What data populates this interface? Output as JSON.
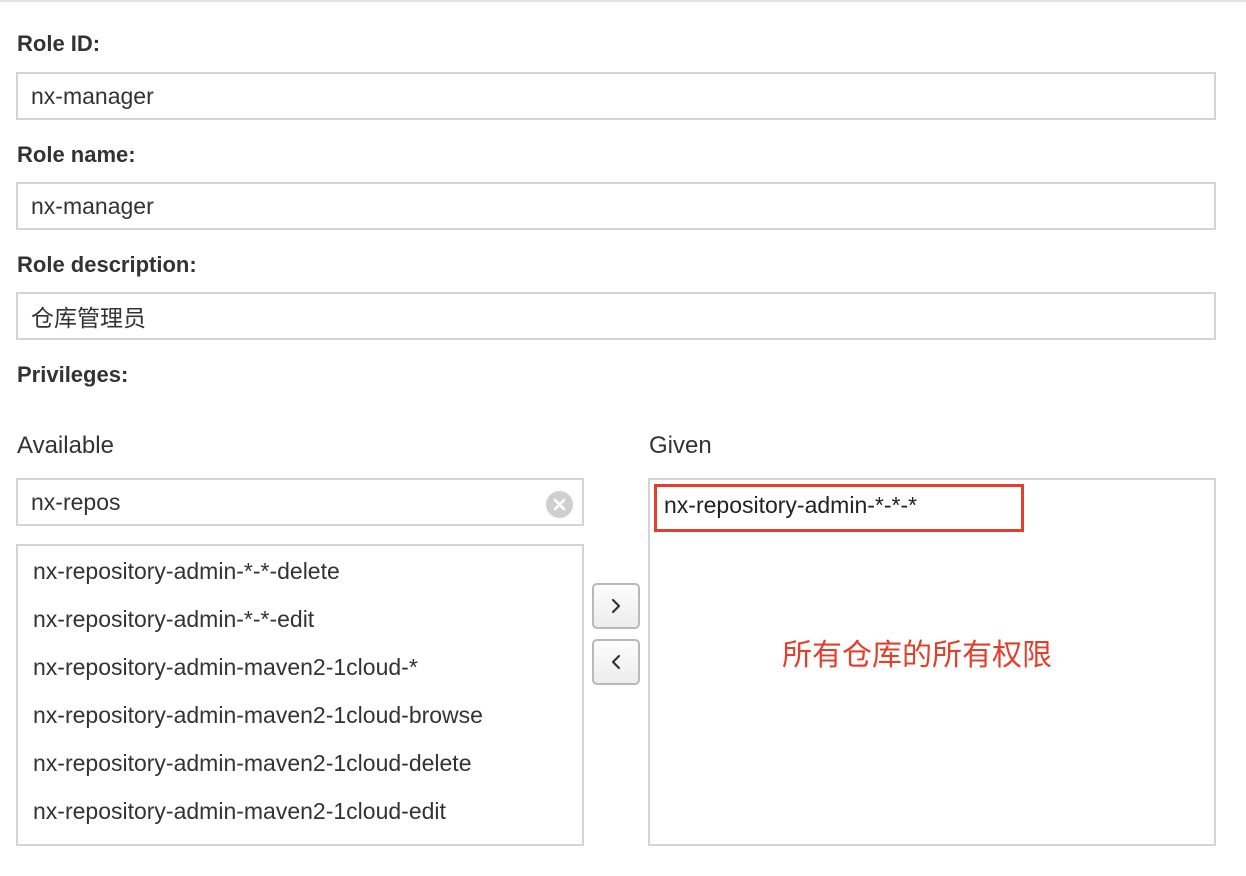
{
  "form": {
    "role_id": {
      "label": "Role ID:",
      "value": "nx-manager"
    },
    "role_name": {
      "label": "Role name:",
      "value": "nx-manager"
    },
    "role_description": {
      "label": "Role description:",
      "value": "仓库管理员"
    },
    "privileges_label": "Privileges:"
  },
  "privileges": {
    "available": {
      "heading": "Available",
      "filter_value": "nx-repos",
      "items": [
        "nx-repository-admin-*-*-delete",
        "nx-repository-admin-*-*-edit",
        "nx-repository-admin-maven2-1cloud-*",
        "nx-repository-admin-maven2-1cloud-browse",
        "nx-repository-admin-maven2-1cloud-delete",
        "nx-repository-admin-maven2-1cloud-edit"
      ]
    },
    "given": {
      "heading": "Given",
      "items": [
        "nx-repository-admin-*-*-*"
      ]
    },
    "add_button_glyph": "›",
    "remove_button_glyph": "‹",
    "annotation": "所有仓库的所有权限"
  },
  "colors": {
    "annotation": "#e0402c",
    "border": "#d4d4d4",
    "text": "#333333"
  },
  "icons": {
    "filter_clear": "clear-circle-icon",
    "add": "chevron-right-icon",
    "remove": "chevron-left-icon"
  }
}
